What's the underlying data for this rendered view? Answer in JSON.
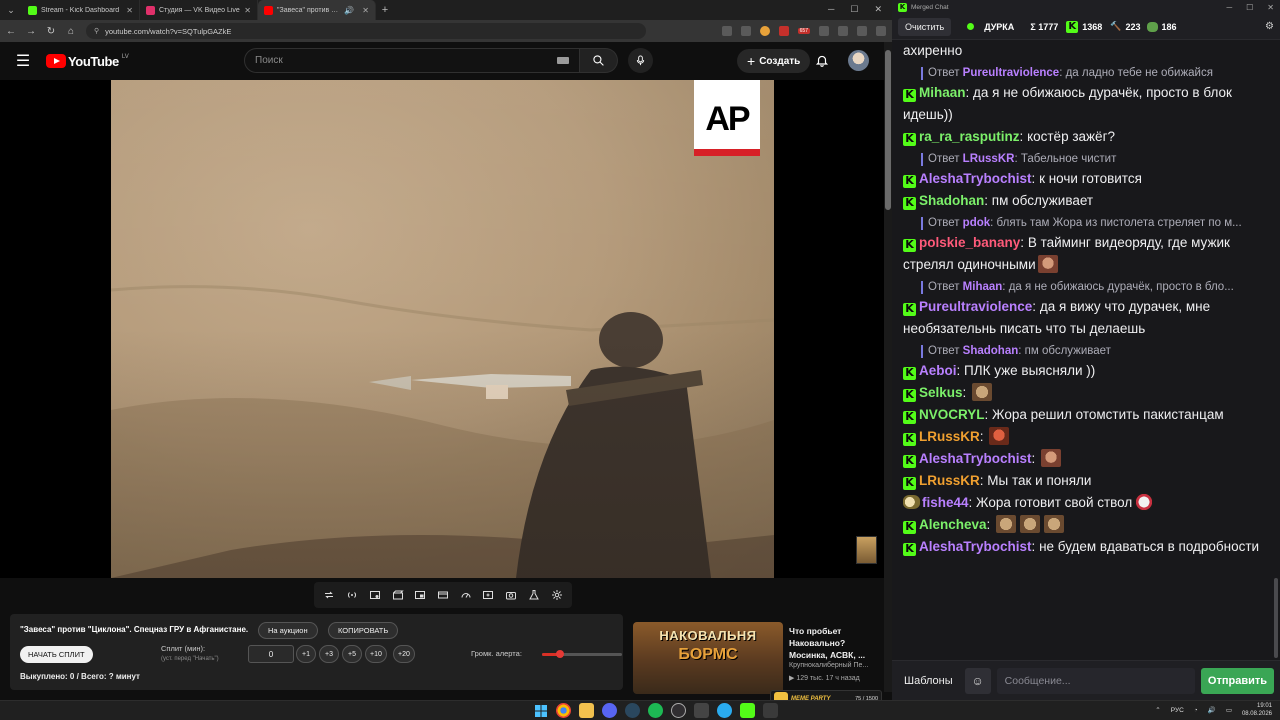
{
  "browser": {
    "tabs": [
      {
        "title": "Stream - Kick Dashboard",
        "color": "#53fc18",
        "active": false
      },
      {
        "title": "Студия — VK Видео Live",
        "color": "#e0306a",
        "active": false
      },
      {
        "title": "\"Завеса\" против \"Циклона\". Спецназ ГРУ в Афганистане.",
        "color": "#ff0000",
        "active": true
      }
    ],
    "url": "youtube.com/watch?v=SQTulpGAZkE",
    "ext_badge": "657"
  },
  "youtube": {
    "logo_text": "YouTube",
    "region": "LV",
    "search_placeholder": "Поиск",
    "create_label": "Создать"
  },
  "video": {
    "watermark": "AP"
  },
  "split_panel": {
    "title": "\"Завеса\" против \"Циклона\". Спецназ ГРУ в Афганистане.",
    "auction_button": "На аукцион",
    "copy_button": "КОПИРОВАТЬ",
    "start_button": "НАЧАТЬ СПЛИТ",
    "split_label": "Сплит (мин):",
    "split_sub": "(уст. перед \"Начать\")",
    "split_value": "0",
    "increments": [
      "+1",
      "+3",
      "+5",
      "+10",
      "+20"
    ],
    "volume_label": "Громк. алерта:",
    "volume_fraction": 0.22,
    "footer": "Выкуплено: 0 / Всего: ? минут"
  },
  "recommended": {
    "thumb_line1": "НАКОВАЛЬНЯ",
    "thumb_line2": "БОРМС",
    "title": "Что пробьет Наковально? Мосинка, АСВК, ...",
    "channel": "Крупнокалиберный Пе...",
    "meta": "▶ 129 тыс.  17 ч назад",
    "meme_label": "MEME PARTY",
    "meme_count": "75 / 1500"
  },
  "chat": {
    "window_title": "Merged Chat",
    "clear_label": "Очистить",
    "channel": "ДУРКА",
    "total": "Σ 1777",
    "kick_count": "1368",
    "twitch_count": "223",
    "other_count": "186",
    "messages": [
      {
        "type": "text",
        "text": "ахиренно"
      },
      {
        "type": "reply",
        "name": "Pureultraviolence",
        "name_color": "#b980ff",
        "text": "да ладно тебе не обижайся"
      },
      {
        "type": "msg",
        "name": "Mihaan",
        "color": "#7cf06a",
        "text": "да я не обижаюсь дурачёк, просто в блок идешь))"
      },
      {
        "type": "msg",
        "name": "ra_ra_rasputinz",
        "color": "#7cf06a",
        "text": "костёр зажёг?"
      },
      {
        "type": "reply",
        "name": "LRussKR",
        "name_color": "#b980ff",
        "text": "Табельное чистит"
      },
      {
        "type": "msg",
        "name": "AleshaTrybochist",
        "color": "#b980ff",
        "text": "к ночи готовится"
      },
      {
        "type": "msg",
        "name": "Shadohan",
        "color": "#7cf06a",
        "text": "пм обслуживает"
      },
      {
        "type": "reply",
        "name": "pdok",
        "name_color": "#b980ff",
        "text": "блять там Жора из пистолета стреляет по м..."
      },
      {
        "type": "msg",
        "name": "polskie_banany",
        "color": "#ff5a7a",
        "text": "В тайминг видеоряду, где мужик стрелял одиночными",
        "emote": "face"
      },
      {
        "type": "reply",
        "name": "Mihaan",
        "name_color": "#b980ff",
        "text": "да я не обижаюсь дурачёк, просто в бло..."
      },
      {
        "type": "msg",
        "name": "Pureultraviolence",
        "color": "#b980ff",
        "text": "да я вижу что дурачек, мне необязательнь писать что ты делаешь"
      },
      {
        "type": "reply",
        "name": "Shadohan",
        "name_color": "#b980ff",
        "text": "пм обслуживает"
      },
      {
        "type": "msg",
        "name": "Aeboi",
        "color": "#b980ff",
        "text": "ПЛК уже выясняли ))"
      },
      {
        "type": "msg",
        "name": "Selkus",
        "color": "#7cf06a",
        "text": "",
        "emote": "cat"
      },
      {
        "type": "msg",
        "name": "NVOCRYL",
        "color": "#7cf06a",
        "text": "Жора решил отомстить пакистанцам"
      },
      {
        "type": "msg",
        "name": "LRussKR",
        "color": "#f0a030",
        "text": "",
        "emote": "red"
      },
      {
        "type": "msg",
        "name": "AleshaTrybochist",
        "color": "#b980ff",
        "text": "",
        "emote": "face"
      },
      {
        "type": "msg",
        "name": "LRussKR",
        "color": "#f0a030",
        "text": "Мы так и поняли"
      },
      {
        "type": "msg",
        "name": "fishe44",
        "color": "#b980ff",
        "text": "Жора готовит свой ствол",
        "emote": "pepe",
        "badge": "dog"
      },
      {
        "type": "msg",
        "name": "Alencheva",
        "color": "#7cf06a",
        "text": "",
        "emote": "cat3"
      },
      {
        "type": "msg",
        "name": "AleshaTrybochist",
        "color": "#b980ff",
        "text": "не будем вдаваться в подробности"
      }
    ],
    "templates_label": "Шаблоны",
    "input_placeholder": "Сообщение...",
    "send_label": "Отправить"
  },
  "taskbar": {
    "lang": "РУС",
    "time": "19:01",
    "date": "08.08.2026"
  },
  "colors": {
    "kick_green": "#53fc18",
    "yt_red": "#ff0000",
    "send_green": "#3aa655"
  }
}
